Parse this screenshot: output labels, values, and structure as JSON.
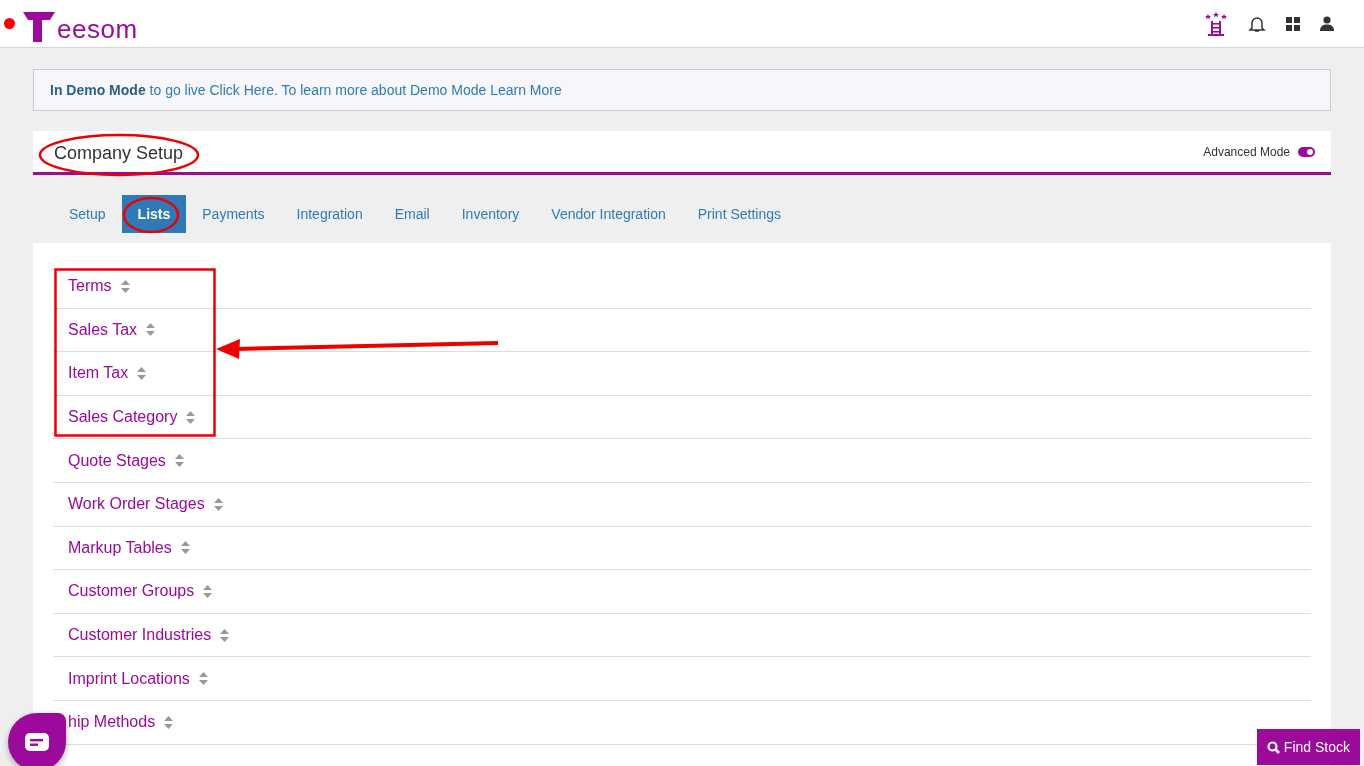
{
  "logo": {
    "text": "eesom"
  },
  "banner": {
    "text": "**In Demo Mode** to go live Click Here. To learn more about Demo Mode Learn More"
  },
  "page": {
    "title": "Company Setup",
    "advanced_mode": {
      "label": "Advanced Mode",
      "on": true
    }
  },
  "tabs": [
    {
      "label": "Setup",
      "selected": false
    },
    {
      "label": "Lists",
      "selected": true
    },
    {
      "label": "Payments",
      "selected": false
    },
    {
      "label": "Integration",
      "selected": false
    },
    {
      "label": "Email",
      "selected": false
    },
    {
      "label": "Inventory",
      "selected": false
    },
    {
      "label": "Vendor Integration",
      "selected": false
    },
    {
      "label": "Print Settings",
      "selected": false
    }
  ],
  "lists": [
    {
      "label": "Terms"
    },
    {
      "label": "Sales Tax"
    },
    {
      "label": "Item Tax"
    },
    {
      "label": "Sales Category"
    },
    {
      "label": "Quote Stages"
    },
    {
      "label": "Work Order Stages"
    },
    {
      "label": "Markup Tables"
    },
    {
      "label": "Customer Groups"
    },
    {
      "label": "Customer Industries"
    },
    {
      "label": "Imprint Locations"
    },
    {
      "label": "hip Methods"
    }
  ],
  "find_stock": {
    "label": "Find Stock"
  }
}
